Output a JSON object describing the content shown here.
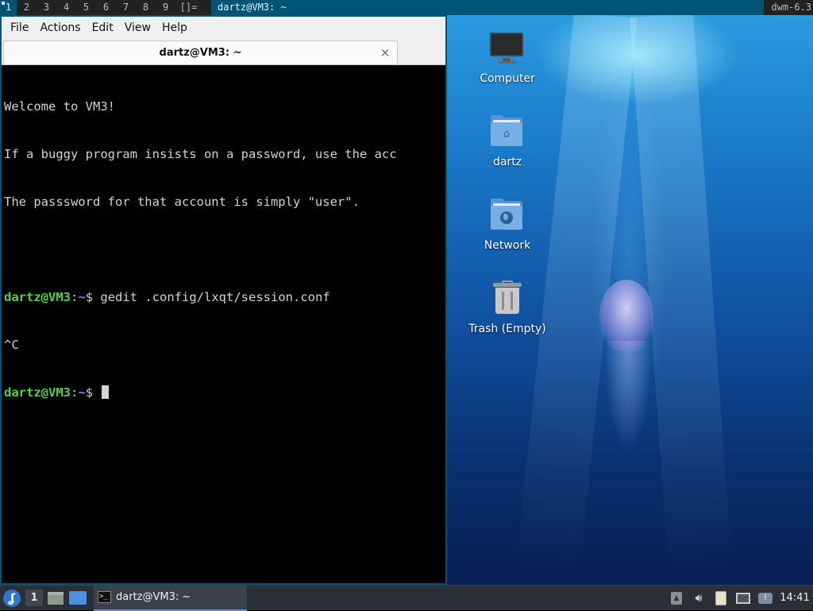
{
  "dwm": {
    "tags": [
      "1",
      "2",
      "3",
      "4",
      "5",
      "6",
      "7",
      "8",
      "9"
    ],
    "active_tag": "1",
    "layout_symbol": "[]=",
    "window_title": "dartz@VM3: ~",
    "status": "dwm-6.3"
  },
  "terminal": {
    "menu": [
      "File",
      "Actions",
      "Edit",
      "View",
      "Help"
    ],
    "tab_title": "dartz@VM3: ~",
    "tab_close": "×",
    "lines": [
      "Welcome to VM3!",
      "If a buggy program insists on a password, use the acc",
      "The passsword for that account is simply \"user\"."
    ],
    "prompt_user": "dartz@VM3",
    "prompt_sep": ":",
    "prompt_path": "~",
    "prompt_dollar": "$ ",
    "command_1": "gedit .config/lxqt/session.conf",
    "interrupt": "^C",
    "command_2": ""
  },
  "desktop": {
    "icons": [
      {
        "label": "Computer",
        "icon": "computer-icon"
      },
      {
        "label": "dartz",
        "icon": "home-folder-icon"
      },
      {
        "label": "Network",
        "icon": "network-folder-icon"
      },
      {
        "label": "Trash (Empty)",
        "icon": "trash-icon"
      }
    ]
  },
  "taskbar": {
    "desktop_number": "1",
    "task_label": "dartz@VM3: ~",
    "clock": "14:41"
  },
  "colors": {
    "dwm_accent": "#005577",
    "prompt_user": "#55d14a",
    "prompt_path": "#6f8ef7",
    "panel_bg": "#2b3036"
  }
}
